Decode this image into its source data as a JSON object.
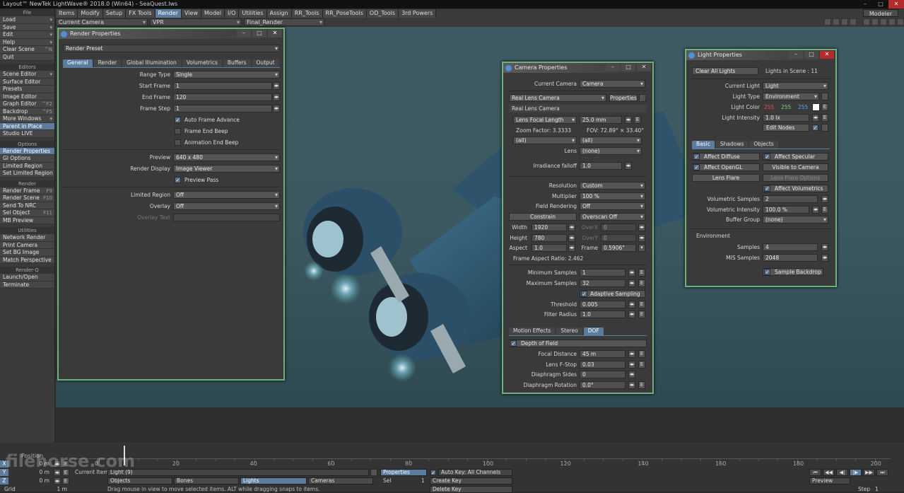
{
  "app": {
    "title": "Layout™ NewTek LightWave® 2018.0 (Win64) - SeaQuest.lws",
    "win_min": "–",
    "win_max": "□",
    "win_close": "✕"
  },
  "menu": {
    "tabs": [
      "Items",
      "Modify",
      "Setup",
      "FX Tools",
      "Render",
      "View",
      "Model",
      "I/O",
      "Utilities",
      "Assign",
      "RR_Tools",
      "RR_PoseTools",
      "OD_Tools",
      "3rd Powers"
    ],
    "modeler": "Modeler"
  },
  "toolbar": {
    "camera": "Current Camera",
    "vpr": "VPR",
    "final": "Final_Render"
  },
  "sidebar": {
    "file_head": "File",
    "file": [
      {
        "label": "Load",
        "dd": "▾"
      },
      {
        "label": "Save",
        "dd": "▾"
      },
      {
        "label": "Edit",
        "dd": "▾"
      },
      {
        "label": "Help",
        "dd": "▾"
      }
    ],
    "clear_scene": "Clear Scene",
    "clear_key": "^N",
    "quit": "Quit",
    "editors_head": "Editors",
    "editors": [
      {
        "label": "Scene Editor",
        "dd": "▾"
      },
      {
        "label": "Surface Editor",
        "dd": ""
      },
      {
        "label": "Presets",
        "dd": ""
      },
      {
        "label": "Image Editor",
        "dd": ""
      },
      {
        "label": "Graph Editor",
        "dd": "^F2"
      },
      {
        "label": "Backdrop",
        "dd": "^F5"
      }
    ],
    "more_windows": "More Windows",
    "more_dd": "▾",
    "parent_in_place": "Parent in Place",
    "studio_live": "Studio LIVE",
    "options_head": "Options",
    "options": [
      "Render Properties",
      "GI Options",
      "Limited Region",
      "Set Limited Region"
    ],
    "render_head": "Render",
    "render": [
      {
        "label": "Render Frame",
        "key": "F9"
      },
      {
        "label": "Render Scene",
        "key": "F10"
      },
      {
        "label": "Send To NRC",
        "key": ""
      },
      {
        "label": "Sel Object",
        "key": "F11"
      },
      {
        "label": "MB Preview",
        "key": ""
      }
    ],
    "utilities_head": "Utilities",
    "utilities": [
      "Network Render",
      "Print Camera",
      "Set BG Image",
      "Match Perspective"
    ],
    "renderq_head": "Render-Q",
    "renderq": [
      "Launch/Open",
      "Terminate"
    ]
  },
  "render_props": {
    "title": "Render Properties",
    "preset": "Render Preset",
    "tabs": [
      "General",
      "Render",
      "Global Illumination",
      "Volumetrics",
      "Buffers",
      "Output"
    ],
    "range_type_lbl": "Range Type",
    "range_type": "Single",
    "start_frame_lbl": "Start Frame",
    "start_frame": "1",
    "end_frame_lbl": "End Frame",
    "end_frame": "120",
    "frame_step_lbl": "Frame Step",
    "frame_step": "1",
    "auto_frame": "Auto Frame Advance",
    "frame_end_beep": "Frame End Beep",
    "anim_end_beep": "Animation End Beep",
    "preview_lbl": "Preview",
    "preview": "640 x 480",
    "render_display_lbl": "Render Display",
    "render_display": "Image Viewer",
    "preview_pass": "Preview Pass",
    "limited_region_lbl": "Limited Region",
    "limited_region": "Off",
    "overlay_lbl": "Overlay",
    "overlay": "Off",
    "overlay_text_lbl": "Overlay Text",
    "spin": "◂▸",
    "check": "✓"
  },
  "camera_props": {
    "title": "Camera Properties",
    "current_camera_lbl": "Current Camera",
    "current_camera": "Camera",
    "type": "Real Lens Camera",
    "properties_btn": "Properties",
    "section": "Real Lens Camera",
    "focal_sel": "Lens Focal Length",
    "focal_val": "25.0 mm",
    "zoom_factor": "Zoom Factor: 3.3333",
    "fov": "FOV: 72.89° × 33.40°",
    "all1": "(all)",
    "all2": "(all)",
    "lens_lbl": "Lens",
    "lens": "(none)",
    "irradiance_lbl": "Irradiance falloff",
    "irradiance": "1.0",
    "resolution_lbl": "Resolution",
    "resolution": "Custom",
    "multiplier_lbl": "Multiplier",
    "multiplier": "100 %",
    "field_lbl": "Field Rendering",
    "field": "Off",
    "constrain_btn": "Constrain",
    "overscan": "Overscan Off",
    "width_lbl": "Width",
    "width": "1920",
    "overx_lbl": "OverX",
    "overx": "0",
    "height_lbl": "Height",
    "height": "780",
    "overy_lbl": "OverY",
    "overy": "0",
    "aspect_lbl": "Aspect",
    "aspect": "1.0",
    "frame_lbl": "Frame",
    "frame": "0.5906\"",
    "frame_aspect": "Frame Aspect Ratio: 2.462",
    "min_samples_lbl": "Minimum Samples",
    "min_samples": "1",
    "max_samples_lbl": "Maximum Samples",
    "max_samples": "32",
    "adaptive": "Adaptive Sampling",
    "threshold_lbl": "Threshold",
    "threshold": "0.005",
    "filter_lbl": "Filter Radius",
    "filter": "1.0",
    "tabs": [
      "Motion Effects",
      "Stereo",
      "DOF"
    ],
    "dof": "Depth of Field",
    "focal_dist_lbl": "Focal Distance",
    "focal_dist": "45 m",
    "fstop_lbl": "Lens F-Stop",
    "fstop": "0.03",
    "diaph_sides_lbl": "Diaphragm Sides",
    "diaph_sides": "0",
    "diaph_rot_lbl": "Diaphragm Rotation",
    "diaph_rot": "0.0°",
    "e": "E",
    "spin": "◂▸",
    "check": "✓"
  },
  "light_props": {
    "title": "Light Properties",
    "clear_all": "Clear All Lights",
    "lights_in_scene": "Lights in Scene : 11",
    "current_light_lbl": "Current Light",
    "current_light": "Light",
    "light_type_lbl": "Light Type",
    "light_type": "Environment",
    "light_color_lbl": "Light Color",
    "r": "255",
    "g": "255",
    "b": "255",
    "intensity_lbl": "Light Intensity",
    "intensity": "1.0 lx",
    "edit_nodes": "Edit Nodes",
    "tabs": [
      "Basic",
      "Shadows",
      "Objects"
    ],
    "affect_diffuse": "Affect Diffuse",
    "affect_specular": "Affect Specular",
    "affect_opengl": "Affect OpenGL",
    "visible_camera": "Visible to Camera",
    "lens_flare": "Lens Flare",
    "lens_flare_opts": "Lens Flare Options",
    "affect_volumetrics": "Affect Volumetrics",
    "vol_samples_lbl": "Volumetric Samples",
    "vol_samples": "2",
    "vol_intensity_lbl": "Volumetric Intensity",
    "vol_intensity": "100.0 %",
    "buffer_group_lbl": "Buffer Group",
    "buffer_group": "(none)",
    "environment": "Environment",
    "samples_lbl": "Samples",
    "samples": "4",
    "mis_lbl": "MIS Samples",
    "mis": "2048",
    "sample_backdrop": "Sample Backdrop",
    "e": "E",
    "spin": "◂▸",
    "check": "✓",
    "lock": "🔒",
    "colors": {
      "r": "#e05050",
      "g": "#7ed37e",
      "b": "#6aa0e6"
    }
  },
  "timeline": {
    "position": "Position",
    "ticks": [
      "0",
      "20",
      "40",
      "60",
      "80",
      "100",
      "120",
      "140",
      "160",
      "180",
      "200"
    ],
    "end_tick": "200",
    "x_lbl": "X",
    "x_val": "0 m",
    "y_lbl": "Y",
    "y_val": "0 m",
    "z_lbl": "Z",
    "z_val": "0 m",
    "grid_lbl": "Grid",
    "grid_val": "1 m",
    "current_item_lbl": "Current Item",
    "current_item": "Light (9)",
    "properties": "Properties",
    "auto_key": "Auto Key: All Channels",
    "objects": "Objects",
    "bones": "Bones",
    "lights": "Lights",
    "cameras": "Cameras",
    "sel_lbl": "Sel",
    "sel": "1",
    "create_key": "Create Key",
    "delete_key": "Delete Key",
    "hint": "Drag mouse in view to move selected items. ALT while dragging snaps to items.",
    "preview": "Preview",
    "step_lbl": "Step",
    "step": "1",
    "play_btns": [
      "⏮",
      "◀◀",
      "◀|",
      "|▶",
      "▶▶",
      "⏭"
    ]
  },
  "watermark": "filehorse.com"
}
